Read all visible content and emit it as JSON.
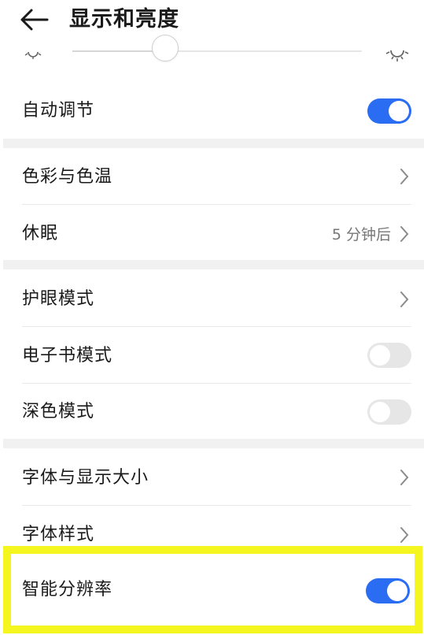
{
  "header": {
    "title": "显示和亮度",
    "back_icon": "arrow-left-icon"
  },
  "brightness": {
    "level_percent": 32,
    "low_icon": "sun-dim-icon",
    "high_icon": "sun-bright-icon"
  },
  "groups": [
    {
      "items": [
        {
          "label": "自动调节",
          "control": "toggle",
          "checked": true
        }
      ]
    },
    {
      "items": [
        {
          "label": "色彩与色温",
          "control": "chevron"
        },
        {
          "label": "休眠",
          "control": "chevron",
          "value": "5 分钟后"
        }
      ]
    },
    {
      "items": [
        {
          "label": "护眼模式",
          "control": "chevron"
        },
        {
          "label": "电子书模式",
          "control": "toggle",
          "checked": false
        },
        {
          "label": "深色模式",
          "control": "toggle",
          "checked": false
        }
      ]
    },
    {
      "items": [
        {
          "label": "字体与显示大小",
          "control": "chevron"
        },
        {
          "label": "字体样式",
          "control": "chevron"
        },
        {
          "label": "智能分辨率",
          "control": "toggle",
          "checked": true,
          "highlighted": true
        }
      ]
    }
  ],
  "colors": {
    "accent": "#2a6cf2",
    "toggle_off": "#e6e6e6",
    "highlight_border": "#f5f520",
    "group_gap": "#f1f1f1"
  }
}
